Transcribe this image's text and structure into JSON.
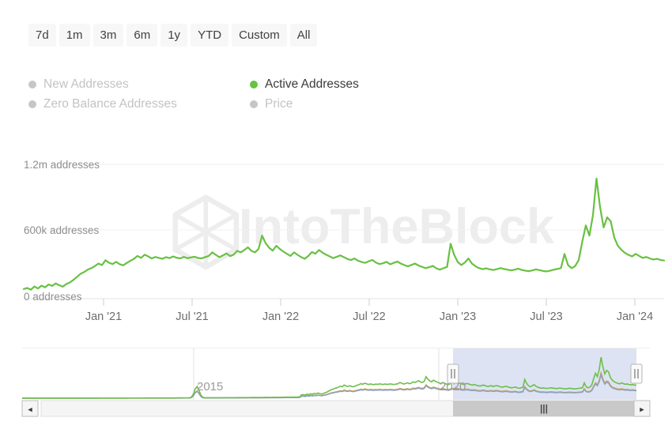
{
  "toolbar": {
    "ranges": [
      {
        "id": "7d",
        "label": "7d"
      },
      {
        "id": "1m",
        "label": "1m"
      },
      {
        "id": "3m",
        "label": "3m"
      },
      {
        "id": "6m",
        "label": "6m"
      },
      {
        "id": "1y",
        "label": "1y"
      },
      {
        "id": "ytd",
        "label": "YTD"
      },
      {
        "id": "custom",
        "label": "Custom"
      },
      {
        "id": "all",
        "label": "All"
      }
    ]
  },
  "legend": {
    "items": [
      {
        "label": "New Addresses",
        "active": false,
        "color": "#c6c6c6"
      },
      {
        "label": "Active Addresses",
        "active": true,
        "color": "#68c142"
      },
      {
        "label": "Zero Balance Addresses",
        "active": false,
        "color": "#c6c6c6"
      },
      {
        "label": "Price",
        "active": false,
        "color": "#c6c6c6"
      }
    ]
  },
  "watermark": {
    "text": "IntoTheBlock",
    "color": "#eeeeee"
  },
  "navigator": {
    "axis_labels": [
      "2015",
      "2020"
    ],
    "scroll_left_icon": "◂",
    "scroll_right_icon": "▸",
    "handle_grip": "‖",
    "thumb_grip": "|||",
    "selection_color": "#d7def0",
    "series_colors": {
      "active_addresses": "#6cbf4b",
      "price": "#d6a94a",
      "new_addresses": "#8fa0bd"
    }
  },
  "chart_data": {
    "type": "line",
    "title": "",
    "xlabel": "",
    "ylabel": "addresses",
    "ylim": [
      0,
      1320000
    ],
    "grid": true,
    "legend_position": "top-left",
    "ytick_labels": [
      "1.2m addresses",
      "600k addresses",
      "0 addresses"
    ],
    "ytick_values": [
      1200000,
      600000,
      0
    ],
    "xtick_labels": [
      "Jan '21",
      "Jul '21",
      "Jan '22",
      "Jul '22",
      "Jan '23",
      "Jul '23",
      "Jan '24"
    ],
    "series": [
      {
        "name": "Active Addresses",
        "color": "#68c142",
        "unit": "addresses",
        "values": [
          95000,
          105000,
          88000,
          120000,
          100000,
          128000,
          112000,
          140000,
          125000,
          150000,
          132000,
          118000,
          145000,
          160000,
          185000,
          215000,
          245000,
          262000,
          285000,
          300000,
          320000,
          345000,
          330000,
          378000,
          352000,
          340000,
          362000,
          338000,
          328000,
          352000,
          372000,
          392000,
          420000,
          400000,
          432000,
          415000,
          395000,
          410000,
          400000,
          392000,
          408000,
          398000,
          415000,
          402000,
          396000,
          410000,
          398000,
          405000,
          412000,
          400000,
          396000,
          408000,
          420000,
          455000,
          430000,
          408000,
          425000,
          445000,
          418000,
          432000,
          470000,
          455000,
          478000,
          505000,
          470000,
          455000,
          488000,
          620000,
          545000,
          500000,
          472000,
          520000,
          488000,
          462000,
          440000,
          420000,
          455000,
          430000,
          408000,
          392000,
          420000,
          458000,
          442000,
          478000,
          452000,
          432000,
          415000,
          398000,
          412000,
          425000,
          408000,
          390000,
          380000,
          395000,
          372000,
          360000,
          352000,
          368000,
          380000,
          355000,
          340000,
          348000,
          362000,
          338000,
          352000,
          365000,
          345000,
          330000,
          318000,
          332000,
          345000,
          325000,
          312000,
          300000,
          310000,
          322000,
          298000,
          285000,
          300000,
          312000,
          540000,
          430000,
          360000,
          330000,
          355000,
          395000,
          345000,
          318000,
          300000,
          290000,
          298000,
          288000,
          282000,
          290000,
          300000,
          292000,
          285000,
          278000,
          285000,
          295000,
          282000,
          275000,
          270000,
          278000,
          288000,
          280000,
          272000,
          268000,
          275000,
          285000,
          292000,
          300000,
          440000,
          330000,
          300000,
          320000,
          380000,
          560000,
          720000,
          620000,
          820000,
          1180000,
          900000,
          700000,
          800000,
          760000,
          600000,
          520000,
          480000,
          450000,
          430000,
          415000,
          440000,
          420000,
          400000,
          410000,
          395000,
          385000,
          392000,
          380000,
          375000
        ]
      }
    ],
    "navigator_series": [
      {
        "name": "Active Addresses",
        "color": "#6cbf4b"
      },
      {
        "name": "Price",
        "color": "#d6a94a"
      },
      {
        "name": "New Addresses",
        "color": "#8fa0bd"
      }
    ]
  }
}
